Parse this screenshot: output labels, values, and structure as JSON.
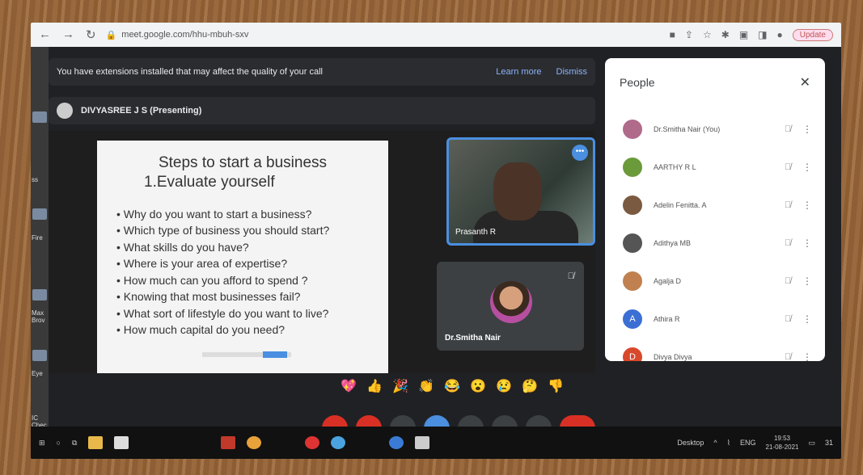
{
  "browser": {
    "url": "meet.google.com/hhu-mbuh-sxv",
    "update_label": "Update"
  },
  "banner": {
    "message": "You have extensions installed that may affect the quality of your call",
    "learn_more": "Learn more",
    "dismiss": "Dismiss"
  },
  "presenter": {
    "label": "DIVYASREE J S (Presenting)"
  },
  "slide": {
    "title": "Steps to start a business",
    "subtitle": "1.Evaluate yourself",
    "bullets": [
      "Why do you want to start a business?",
      "Which type of business you should start?",
      "What skills do you have?",
      "Where is your area of expertise?",
      "How much can you afford to spend ?",
      "Knowing that most businesses fail?",
      "What sort of lifestyle do you want to live?",
      "How much capital do you need?"
    ]
  },
  "tiles": {
    "tile1_name": "Prasanth R",
    "tile2_name": "Dr.Smitha Nair"
  },
  "people": {
    "title": "People",
    "close": "✕",
    "list": [
      {
        "name": "Dr.Smitha Nair (You)",
        "color": "#b06a8a",
        "initial": ""
      },
      {
        "name": "AARTHY R L",
        "color": "#6a9a3a",
        "initial": ""
      },
      {
        "name": "Adelin Fenitta. A",
        "color": "#7a5a40",
        "initial": ""
      },
      {
        "name": "Adithya MB",
        "color": "#555555",
        "initial": ""
      },
      {
        "name": "Agalja D",
        "color": "#c08050",
        "initial": ""
      },
      {
        "name": "Athira R",
        "color": "#3b6fd4",
        "initial": "A"
      },
      {
        "name": "Divya Divya",
        "color": "#d9482b",
        "initial": "D"
      }
    ]
  },
  "reactions": [
    "💖",
    "👍",
    "🎉",
    "👏",
    "😂",
    "😮",
    "😢",
    "🤔",
    "👎"
  ],
  "taskbar": {
    "desktop_label": "Desktop",
    "lang": "ENG",
    "time": "19:53",
    "date": "21-08-2021",
    "badge": "31"
  },
  "desktop_labels": [
    "ss",
    "Fire",
    "Max Brov",
    "Eye",
    "IC Chec"
  ]
}
